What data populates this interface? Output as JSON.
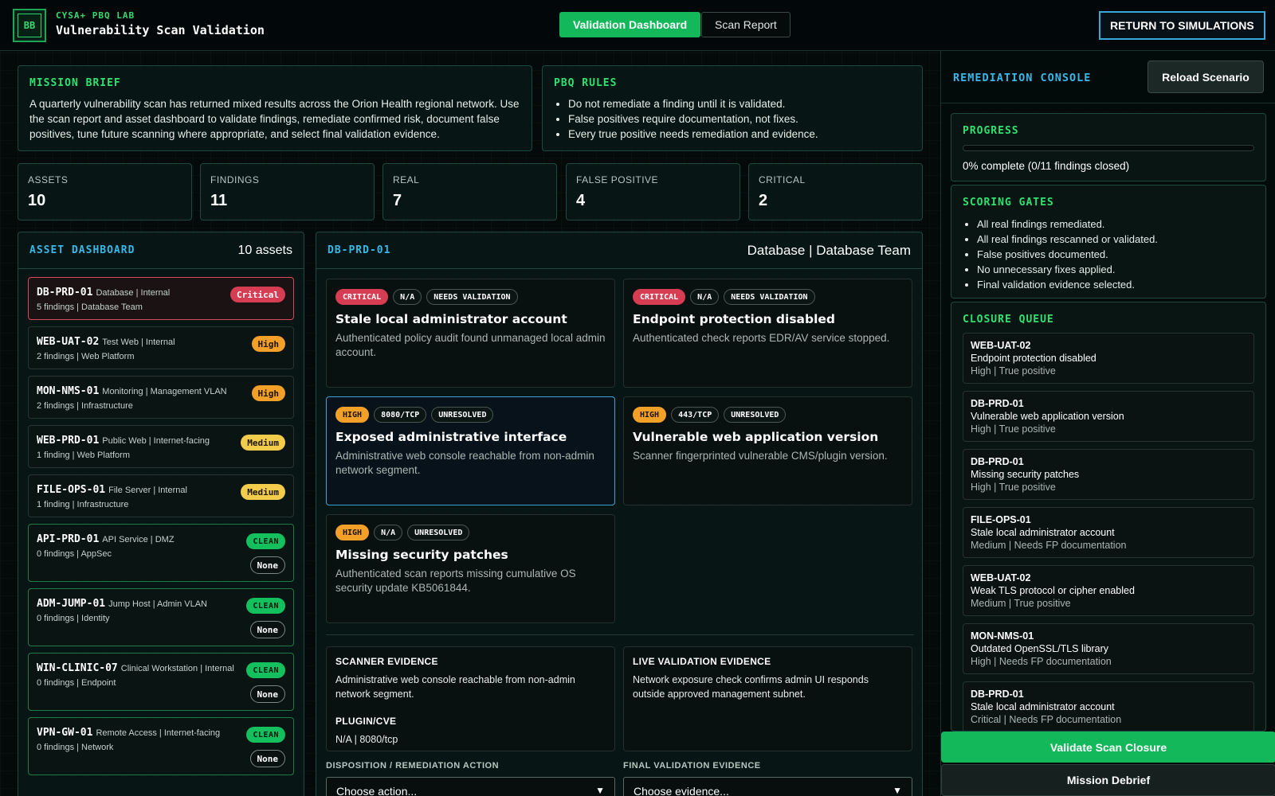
{
  "header": {
    "logo_text": "BB",
    "kicker": "CYSA+ PBQ LAB",
    "title": "Vulnerability Scan Validation",
    "nav": [
      "Validation Dashboard",
      "Scan Report"
    ],
    "return_label": "RETURN TO SIMULATIONS"
  },
  "brief": {
    "title": "MISSION BRIEF",
    "text": "A quarterly vulnerability scan has returned mixed results across the Orion Health regional network. Use the scan report and asset dashboard to validate findings, remediate confirmed risk, document false positives, tune future scanning where appropriate, and select final validation evidence."
  },
  "rules": {
    "title": "PBQ RULES",
    "items": [
      "Do not remediate a finding until it is validated.",
      "False positives require documentation, not fixes.",
      "Every true positive needs remediation and evidence."
    ]
  },
  "stats": [
    {
      "label": "ASSETS",
      "value": "10"
    },
    {
      "label": "FINDINGS",
      "value": "11"
    },
    {
      "label": "REAL",
      "value": "7"
    },
    {
      "label": "FALSE POSITIVE",
      "value": "4"
    },
    {
      "label": "CRITICAL",
      "value": "2"
    }
  ],
  "assets": {
    "title": "ASSET DASHBOARD",
    "count": "10 assets",
    "items": [
      {
        "name": "DB-PRD-01",
        "meta": "Database | Internal",
        "sub": "5 findings | Database Team",
        "badge": "Critical"
      },
      {
        "name": "WEB-UAT-02",
        "meta": "Test Web | Internal",
        "sub": "2 findings | Web Platform",
        "badge": "High"
      },
      {
        "name": "MON-NMS-01",
        "meta": "Monitoring | Management VLAN",
        "sub": "2 findings | Infrastructure",
        "badge": "High"
      },
      {
        "name": "WEB-PRD-01",
        "meta": "Public Web | Internet-facing",
        "sub": "1 finding | Web Platform",
        "badge": "Medium"
      },
      {
        "name": "FILE-OPS-01",
        "meta": "File Server | Internal",
        "sub": "1 finding | Infrastructure",
        "badge": "Medium"
      },
      {
        "name": "API-PRD-01",
        "meta": "API Service | DMZ",
        "sub": "0 findings | AppSec",
        "badge": "CLEAN",
        "extra": "None"
      },
      {
        "name": "ADM-JUMP-01",
        "meta": "Jump Host | Admin VLAN",
        "sub": "0 findings | Identity",
        "badge": "CLEAN",
        "extra": "None"
      },
      {
        "name": "WIN-CLINIC-07",
        "meta": "Clinical Workstation | Internal",
        "sub": "0 findings | Endpoint",
        "badge": "CLEAN",
        "extra": "None"
      },
      {
        "name": "VPN-GW-01",
        "meta": "Remote Access | Internet-facing",
        "sub": "0 findings | Network",
        "badge": "CLEAN",
        "extra": "None"
      }
    ]
  },
  "detail": {
    "asset": "DB-PRD-01",
    "subtitle": "Database | Database Team",
    "findings": [
      {
        "sev": "CRITICAL",
        "port": "N/A",
        "status": "NEEDS VALIDATION",
        "title": "Stale local administrator account",
        "desc": "Authenticated policy audit found unmanaged local admin account."
      },
      {
        "sev": "CRITICAL",
        "port": "N/A",
        "status": "NEEDS VALIDATION",
        "title": "Endpoint protection disabled",
        "desc": "Authenticated check reports EDR/AV service stopped."
      },
      {
        "sev": "HIGH",
        "port": "8080/TCP",
        "status": "UNRESOLVED",
        "title": "Exposed administrative interface",
        "desc": "Administrative web console reachable from non-admin network segment."
      },
      {
        "sev": "HIGH",
        "port": "443/TCP",
        "status": "UNRESOLVED",
        "title": "Vulnerable web application version",
        "desc": "Scanner fingerprinted vulnerable CMS/plugin version."
      },
      {
        "sev": "HIGH",
        "port": "N/A",
        "status": "UNRESOLVED",
        "title": "Missing security patches",
        "desc": "Authenticated scan reports missing cumulative OS security update KB5061844."
      }
    ],
    "scanner_evidence": {
      "title": "SCANNER EVIDENCE",
      "text": "Administrative web console reachable from non-admin network segment.",
      "plugin_label": "PLUGIN/CVE",
      "plugin_value": "N/A | 8080/tcp"
    },
    "live_evidence": {
      "title": "LIVE VALIDATION EVIDENCE",
      "text": "Network exposure check confirms admin UI responds outside approved management subnet."
    },
    "action_label": "DISPOSITION / REMEDIATION ACTION",
    "action_value": "Choose action...",
    "evidence_label": "FINAL VALIDATION EVIDENCE",
    "evidence_value": "Choose evidence..."
  },
  "console": {
    "title": "REMEDIATION CONSOLE",
    "reload": "Reload Scenario",
    "progress_title": "PROGRESS",
    "progress_pct": 0,
    "progress_text": "0% complete (0/11 findings closed)",
    "gates_title": "SCORING GATES",
    "gates": [
      "All real findings remediated.",
      "All real findings rescanned or validated.",
      "False positives documented.",
      "No unnecessary fixes applied.",
      "Final validation evidence selected."
    ],
    "queue_title": "CLOSURE QUEUE",
    "queue": [
      {
        "asset": "WEB-UAT-02",
        "finding": "Endpoint protection disabled",
        "status": "High | True positive"
      },
      {
        "asset": "DB-PRD-01",
        "finding": "Vulnerable web application version",
        "status": "High | True positive"
      },
      {
        "asset": "DB-PRD-01",
        "finding": "Missing security patches",
        "status": "High | True positive"
      },
      {
        "asset": "FILE-OPS-01",
        "finding": "Stale local administrator account",
        "status": "Medium | Needs FP documentation"
      },
      {
        "asset": "WEB-UAT-02",
        "finding": "Weak TLS protocol or cipher enabled",
        "status": "Medium | True positive"
      },
      {
        "asset": "MON-NMS-01",
        "finding": "Outdated OpenSSL/TLS library",
        "status": "High | Needs FP documentation"
      },
      {
        "asset": "DB-PRD-01",
        "finding": "Stale local administrator account",
        "status": "Critical | Needs FP documentation"
      }
    ],
    "validate": "Validate Scan Closure",
    "debrief": "Mission Debrief"
  }
}
